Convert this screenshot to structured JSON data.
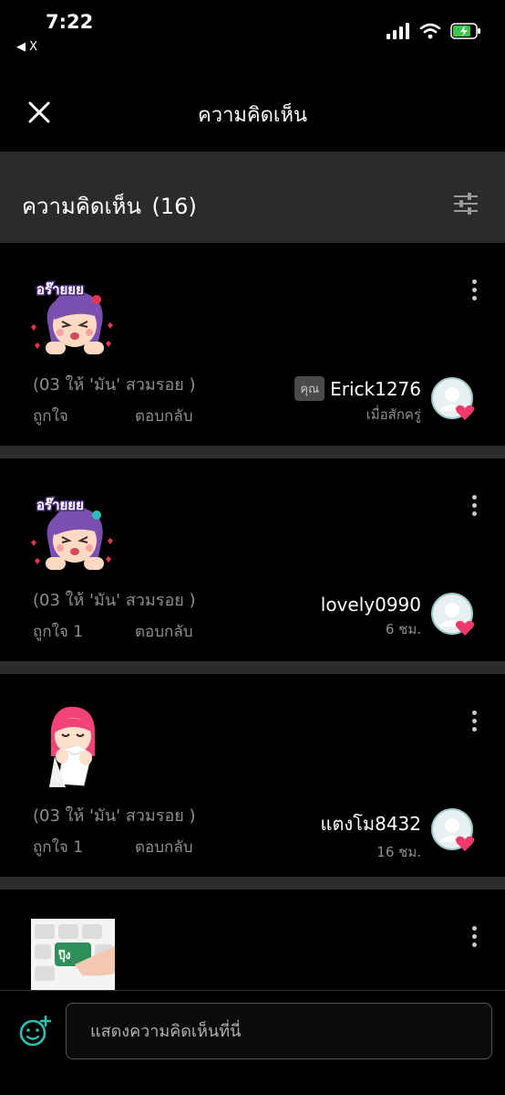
{
  "status_bar": {
    "time": "7:22",
    "back_app": "◀ X",
    "battery_color": "#39c84a"
  },
  "header": {
    "title": "ความคิดเห็น"
  },
  "section": {
    "title": "ความคิดเห็น",
    "count": "(16)"
  },
  "colors": {
    "background": "#000000",
    "section_bg": "#2b2b2b",
    "accent_teal": "#2bbfb4",
    "heart_pink": "#ee3a6a"
  },
  "comments": [
    {
      "sticker_icon": "purple-hair-girl-sticker-icon",
      "sticker_text": "อร๊ายยย",
      "context": "(03 ให้ 'มัน' สวมรอย )",
      "like_label": "ถูกใจ",
      "reply_label": "ตอบกลับ",
      "you_badge": "คุณ",
      "author": "Erick1276",
      "time": "เมื่อสักครู่"
    },
    {
      "sticker_icon": "purple-hair-girl-sticker-icon",
      "sticker_text": "อร๊ายยย",
      "context": "(03 ให้ 'มัน' สวมรอย )",
      "like_label": "ถูกใจ 1",
      "reply_label": "ตอบกลับ",
      "author": "lovely0990",
      "time": "6 ชม."
    },
    {
      "sticker_icon": "crying-girl-tissue-sticker-icon",
      "context": "(03 ให้ 'มัน' สวมรอย )",
      "like_label": "ถูกใจ 1",
      "reply_label": "ตอบกลับ",
      "author": "แตงโม8432",
      "time": "16 ชม."
    },
    {
      "sticker_icon": "keyboard-finger-sticker-icon",
      "sticker_text": "ปุ๊ง"
    }
  ],
  "input": {
    "placeholder": "แสดงความคิดเห็นที่นี่"
  }
}
